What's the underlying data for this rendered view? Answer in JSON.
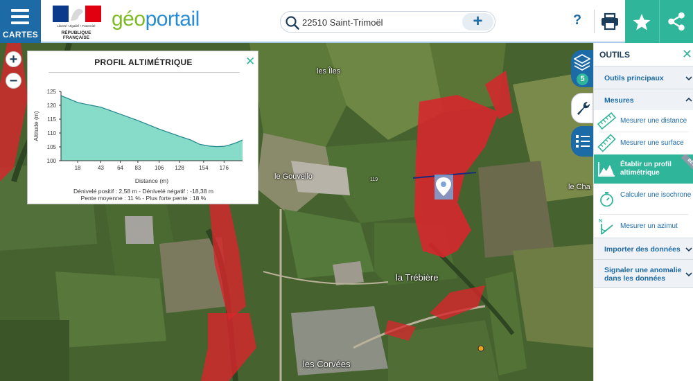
{
  "header": {
    "menu_label": "CARTES",
    "rf_motto": "Liberté • Égalité • Fraternité",
    "rf_name": "RÉPUBLIQUE FRANÇAISE",
    "brand_prefix": "gé",
    "brand_o": "o",
    "brand_suffix": "portail",
    "search_value": "22510 Saint-Trimoël",
    "search_add": "+",
    "help": "?",
    "colors": {
      "blue": "#1c6aa6",
      "green": "#2fb59a",
      "brand_green": "#7dbb26",
      "brand_blue": "#2a8dd1"
    }
  },
  "map": {
    "zoom_in": "+",
    "zoom_out": "−",
    "labels": [
      "les Îles",
      "le Gouvello",
      "le Cha",
      "la Trébière",
      "les Corvées",
      "119"
    ]
  },
  "profile": {
    "title": "PROFIL ALTIMÉTRIQUE",
    "close": "✕",
    "stats_line1": "Dénivelé positif : 2,58 m - Dénivelé négatif : -18,38 m",
    "stats_line2": "Pente moyenne : 11 % - Plus forte pente : 18 %"
  },
  "chart_data": {
    "type": "area",
    "xlabel": "Distance (m)",
    "ylabel": "Altitude (m)",
    "xlim": [
      0,
      196
    ],
    "ylim": [
      100,
      125
    ],
    "yticks": [
      100,
      105,
      110,
      115,
      120,
      125
    ],
    "xticks": [
      18,
      43,
      64,
      83,
      106,
      128,
      154,
      176
    ],
    "x": [
      0,
      18,
      43,
      54,
      64,
      83,
      106,
      128,
      140,
      150,
      160,
      168,
      176,
      182,
      190,
      196
    ],
    "y": [
      123.5,
      121.0,
      119.3,
      118.0,
      116.8,
      114.5,
      111.4,
      108.8,
      107.5,
      105.9,
      105.3,
      105.1,
      105.2,
      105.7,
      106.6,
      107.5
    ],
    "fill_color": "#86dcc8",
    "line_color": "#2a8a8f",
    "grid": false
  },
  "side_tools": {
    "layers_count": "5"
  },
  "panel": {
    "title": "OUTILS",
    "close": "✕",
    "sections": [
      {
        "label": "Outils principaux",
        "state": "collapsed"
      },
      {
        "label": "Mesures",
        "state": "expanded"
      },
      {
        "label": "Importer des données",
        "state": "collapsed"
      },
      {
        "label": "Signaler une anomalie dans les données",
        "state": "collapsed"
      }
    ],
    "items": [
      {
        "label": "Mesurer une distance",
        "icon": "ruler-icon"
      },
      {
        "label": "Mesurer une surface",
        "icon": "ruler-diagonal-icon"
      },
      {
        "label": "Établir un profil altimétrique",
        "icon": "elevation-profile-icon",
        "active": true,
        "badge": "BÊTA"
      },
      {
        "label": "Calculer une isochrone",
        "icon": "stopwatch-icon"
      },
      {
        "label": "Mesurer un azimut",
        "icon": "azimuth-icon"
      }
    ]
  }
}
